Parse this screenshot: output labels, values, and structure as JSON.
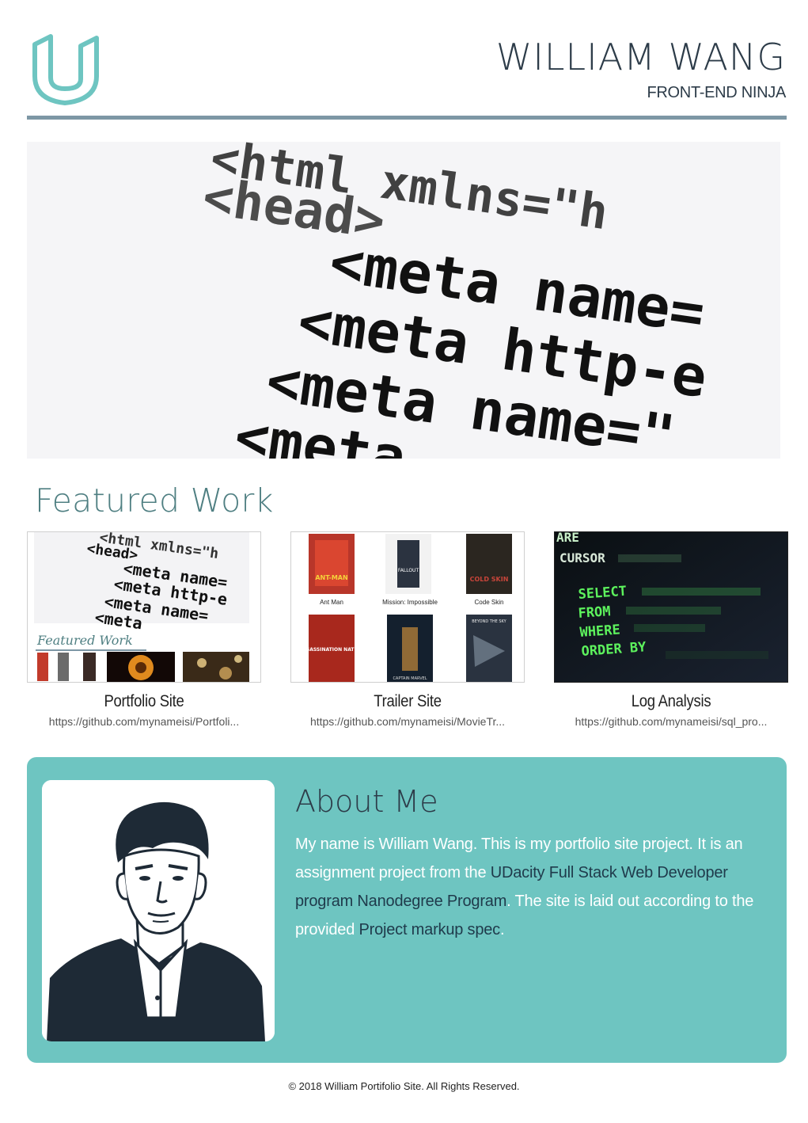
{
  "header": {
    "name": "WILLIAM WANG",
    "role": "FRONT-END NINJA",
    "logo_icon": "udacity-logo-icon"
  },
  "hero": {
    "image": "html-code-closeup-image",
    "code_lines": [
      "<html xmlns=\"h",
      "<head>",
      "<meta name=",
      "<meta http-e",
      "<meta name=\"",
      "<meta"
    ]
  },
  "featured": {
    "title": "Featured Work",
    "projects": [
      {
        "title": "Portfolio Site",
        "link": "https://github.com/mynameisi/Portfoli...",
        "thumb": {
          "code_lines": [
            "<html xmlns=\"h",
            "<head>",
            "<meta name=",
            "<meta http-e",
            "<meta name=",
            "<meta"
          ],
          "mini_title": "Featured Work"
        }
      },
      {
        "title": "Trailer Site",
        "link": "https://github.com/mynameisi/MovieTr...",
        "thumb": {
          "movies": [
            "Ant Man",
            "Mission: Impossible",
            "Code Skin"
          ],
          "posters": [
            "ANT-MAN",
            "FALLOUT",
            "COLD SKIN",
            "ASSASSINATION NATION",
            "CAPTAIN MARVEL",
            "BEYOND THE SKY"
          ]
        }
      },
      {
        "title": "Log Analysis",
        "link": "https://github.com/mynameisi/sql_pro...",
        "thumb": {
          "sql_lines": [
            "ARE",
            "CURSOR",
            "SELECT",
            "FROM",
            "WHERE",
            "ORDER BY"
          ]
        }
      }
    ]
  },
  "about": {
    "title": "About Me",
    "text_1": "My name is William Wang. This is my portfolio site project. It is an assignment project from the ",
    "link_udacity": "UDacity",
    "text_2": " ",
    "link_course": "Full Stack Web Developer program Nanodegree Program",
    "text_3": ". The site is laid out according to the provided ",
    "link_spec": "Project markup spec",
    "text_4": "."
  },
  "footer": {
    "text": "© 2018 William Portifolio Site. All Rights Reserved."
  },
  "colors": {
    "accent": "#6ec5c1",
    "logo": "#6ec5c1",
    "rule": "#7d97a5",
    "heading": "#4f7f82",
    "text": "#2d3c49"
  }
}
